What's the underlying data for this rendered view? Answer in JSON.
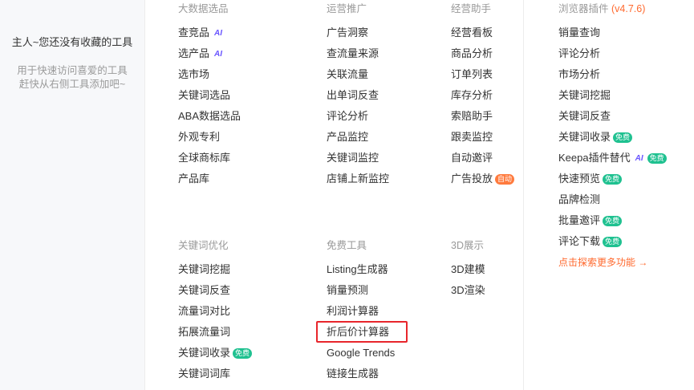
{
  "favorites": {
    "title": "主人~您还没有收藏的工具",
    "hint_line1": "用于快速访问喜爱的工具",
    "hint_line2": "赶快从右侧工具添加吧~"
  },
  "sections": {
    "big_data": {
      "title": "大数据选品",
      "items": [
        {
          "label": "查竞品",
          "tag": "AI"
        },
        {
          "label": "选产品",
          "tag": "AI"
        },
        {
          "label": "选市场"
        },
        {
          "label": "关键词选品"
        },
        {
          "label": "ABA数据选品"
        },
        {
          "label": "外观专利"
        },
        {
          "label": "全球商标库"
        },
        {
          "label": "产品库"
        }
      ]
    },
    "promotion": {
      "title": "运营推广",
      "items": [
        {
          "label": "广告洞察"
        },
        {
          "label": "查流量来源"
        },
        {
          "label": "关联流量"
        },
        {
          "label": "出单词反查"
        },
        {
          "label": "评论分析"
        },
        {
          "label": "产品监控"
        },
        {
          "label": "关键词监控"
        },
        {
          "label": "店铺上新监控"
        }
      ]
    },
    "assistant": {
      "title": "经营助手",
      "items": [
        {
          "label": "经营看板"
        },
        {
          "label": "商品分析"
        },
        {
          "label": "订单列表"
        },
        {
          "label": "库存分析"
        },
        {
          "label": "索赔助手"
        },
        {
          "label": "跟卖监控"
        },
        {
          "label": "自动邀评"
        },
        {
          "label": "广告投放",
          "tag": "自动"
        }
      ]
    },
    "browser_plugin": {
      "title": "浏览器插件",
      "version": "(v4.7.6)",
      "items": [
        {
          "label": "销量查询"
        },
        {
          "label": "评论分析"
        },
        {
          "label": "市场分析"
        },
        {
          "label": "关键词挖掘"
        },
        {
          "label": "关键词反查"
        },
        {
          "label": "关键词收录",
          "tag": "免费"
        },
        {
          "label": "Keepa插件替代",
          "tag": "AI",
          "tag2": "免费"
        },
        {
          "label": "快速预览",
          "tag": "免费"
        },
        {
          "label": "品牌检测"
        },
        {
          "label": "批量邀评",
          "tag": "免费"
        },
        {
          "label": "评论下载",
          "tag": "免费"
        }
      ],
      "explore": "点击探索更多功能 →"
    },
    "keyword_opt": {
      "title": "关键词优化",
      "items": [
        {
          "label": "关键词挖掘"
        },
        {
          "label": "关键词反查"
        },
        {
          "label": "流量词对比"
        },
        {
          "label": "拓展流量词"
        },
        {
          "label": "关键词收录",
          "tag": "免费"
        },
        {
          "label": "关键词词库"
        }
      ]
    },
    "free_tools": {
      "title": "免费工具",
      "items": [
        {
          "label": "Listing生成器"
        },
        {
          "label": "销量预测"
        },
        {
          "label": "利润计算器"
        },
        {
          "label": "折后价计算器"
        },
        {
          "label": "Google Trends"
        },
        {
          "label": "链接生成器"
        }
      ]
    },
    "display3d": {
      "title": "3D展示",
      "items": [
        {
          "label": "3D建模"
        },
        {
          "label": "3D渲染"
        }
      ]
    }
  },
  "ai_tag_text": "AI",
  "colors": {
    "accent_orange": "#ff6a2f",
    "free_green": "#1fc190",
    "highlight_red": "#e8262c"
  }
}
